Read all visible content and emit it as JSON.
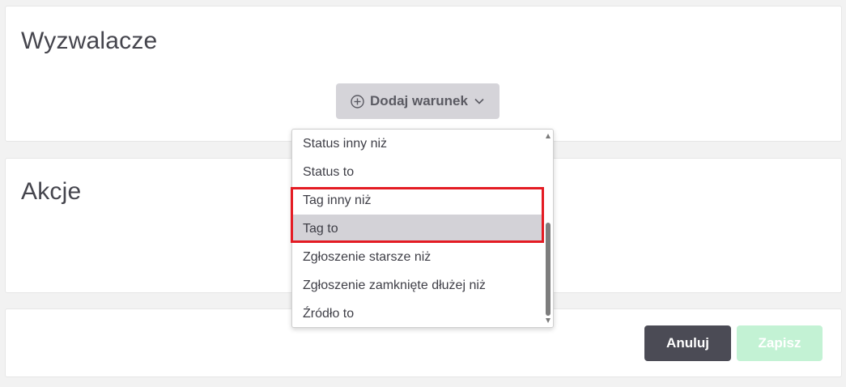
{
  "triggers": {
    "title": "Wyzwalacze",
    "add_condition_label": "Dodaj warunek"
  },
  "actions": {
    "title": "Akcje"
  },
  "dropdown": {
    "options": [
      "Status inny niż",
      "Status to",
      "Tag inny niż",
      "Tag to",
      "Zgłoszenie starsze niż",
      "Zgłoszenie zamknięte dłużej niż",
      "Źródło to"
    ],
    "active_option": "Tag to"
  },
  "footer": {
    "cancel_label": "Anuluj",
    "save_label": "Zapisz"
  },
  "colors": {
    "highlight": "#e41b23",
    "save_disabled": "#c3f2d4",
    "cancel": "#4b4b55"
  }
}
